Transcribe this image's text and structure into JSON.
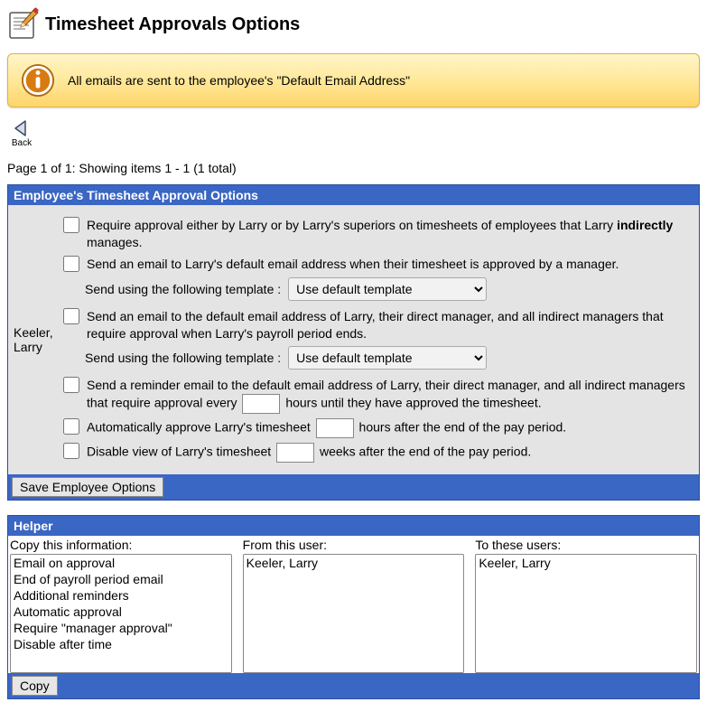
{
  "page_title": "Timesheet Approvals Options",
  "info_message": "All emails are sent to the employee's \"Default Email Address\"",
  "back_label": "Back",
  "pagination": "Page 1 of 1: Showing items 1 - 1 (1 total)",
  "panel1": {
    "title": "Employee's Timesheet Approval Options",
    "save_btn": "Save Employee Options"
  },
  "employee_name": "Keeler, Larry",
  "opts": {
    "require_pre": "Require approval either by Larry or by Larry's superiors on timesheets of employees that Larry ",
    "require_bold": "indirectly",
    "require_post": " manages.",
    "email_approved": "Send an email to Larry's default email address when their timesheet is approved by a manager.",
    "template_label": "Send using the following template :",
    "template_default": "Use default template",
    "email_period_end": "Send an email to the default email address of Larry, their direct manager, and all indirect managers that require approval when Larry's payroll period ends.",
    "reminder_pre": "Send a reminder email to the default email address of Larry, their direct manager, and all indirect managers that require approval every ",
    "reminder_post": " hours until they have approved the timesheet.",
    "auto_pre": "Automatically approve Larry's timesheet ",
    "auto_post": " hours after the end of the pay period.",
    "disable_pre": "Disable view of Larry's timesheet ",
    "disable_post": " weeks after the end of the pay period."
  },
  "helper": {
    "title": "Helper",
    "col1_label": "Copy this information:",
    "col2_label": "From this user:",
    "col3_label": "To these users:",
    "copy_btn": "Copy",
    "info_options": [
      "Email on approval",
      "End of payroll period email",
      "Additional reminders",
      "Automatic approval",
      "Require \"manager approval\"",
      "Disable after time"
    ],
    "from_users": [
      "Keeler, Larry"
    ],
    "to_users": [
      "Keeler, Larry"
    ]
  }
}
